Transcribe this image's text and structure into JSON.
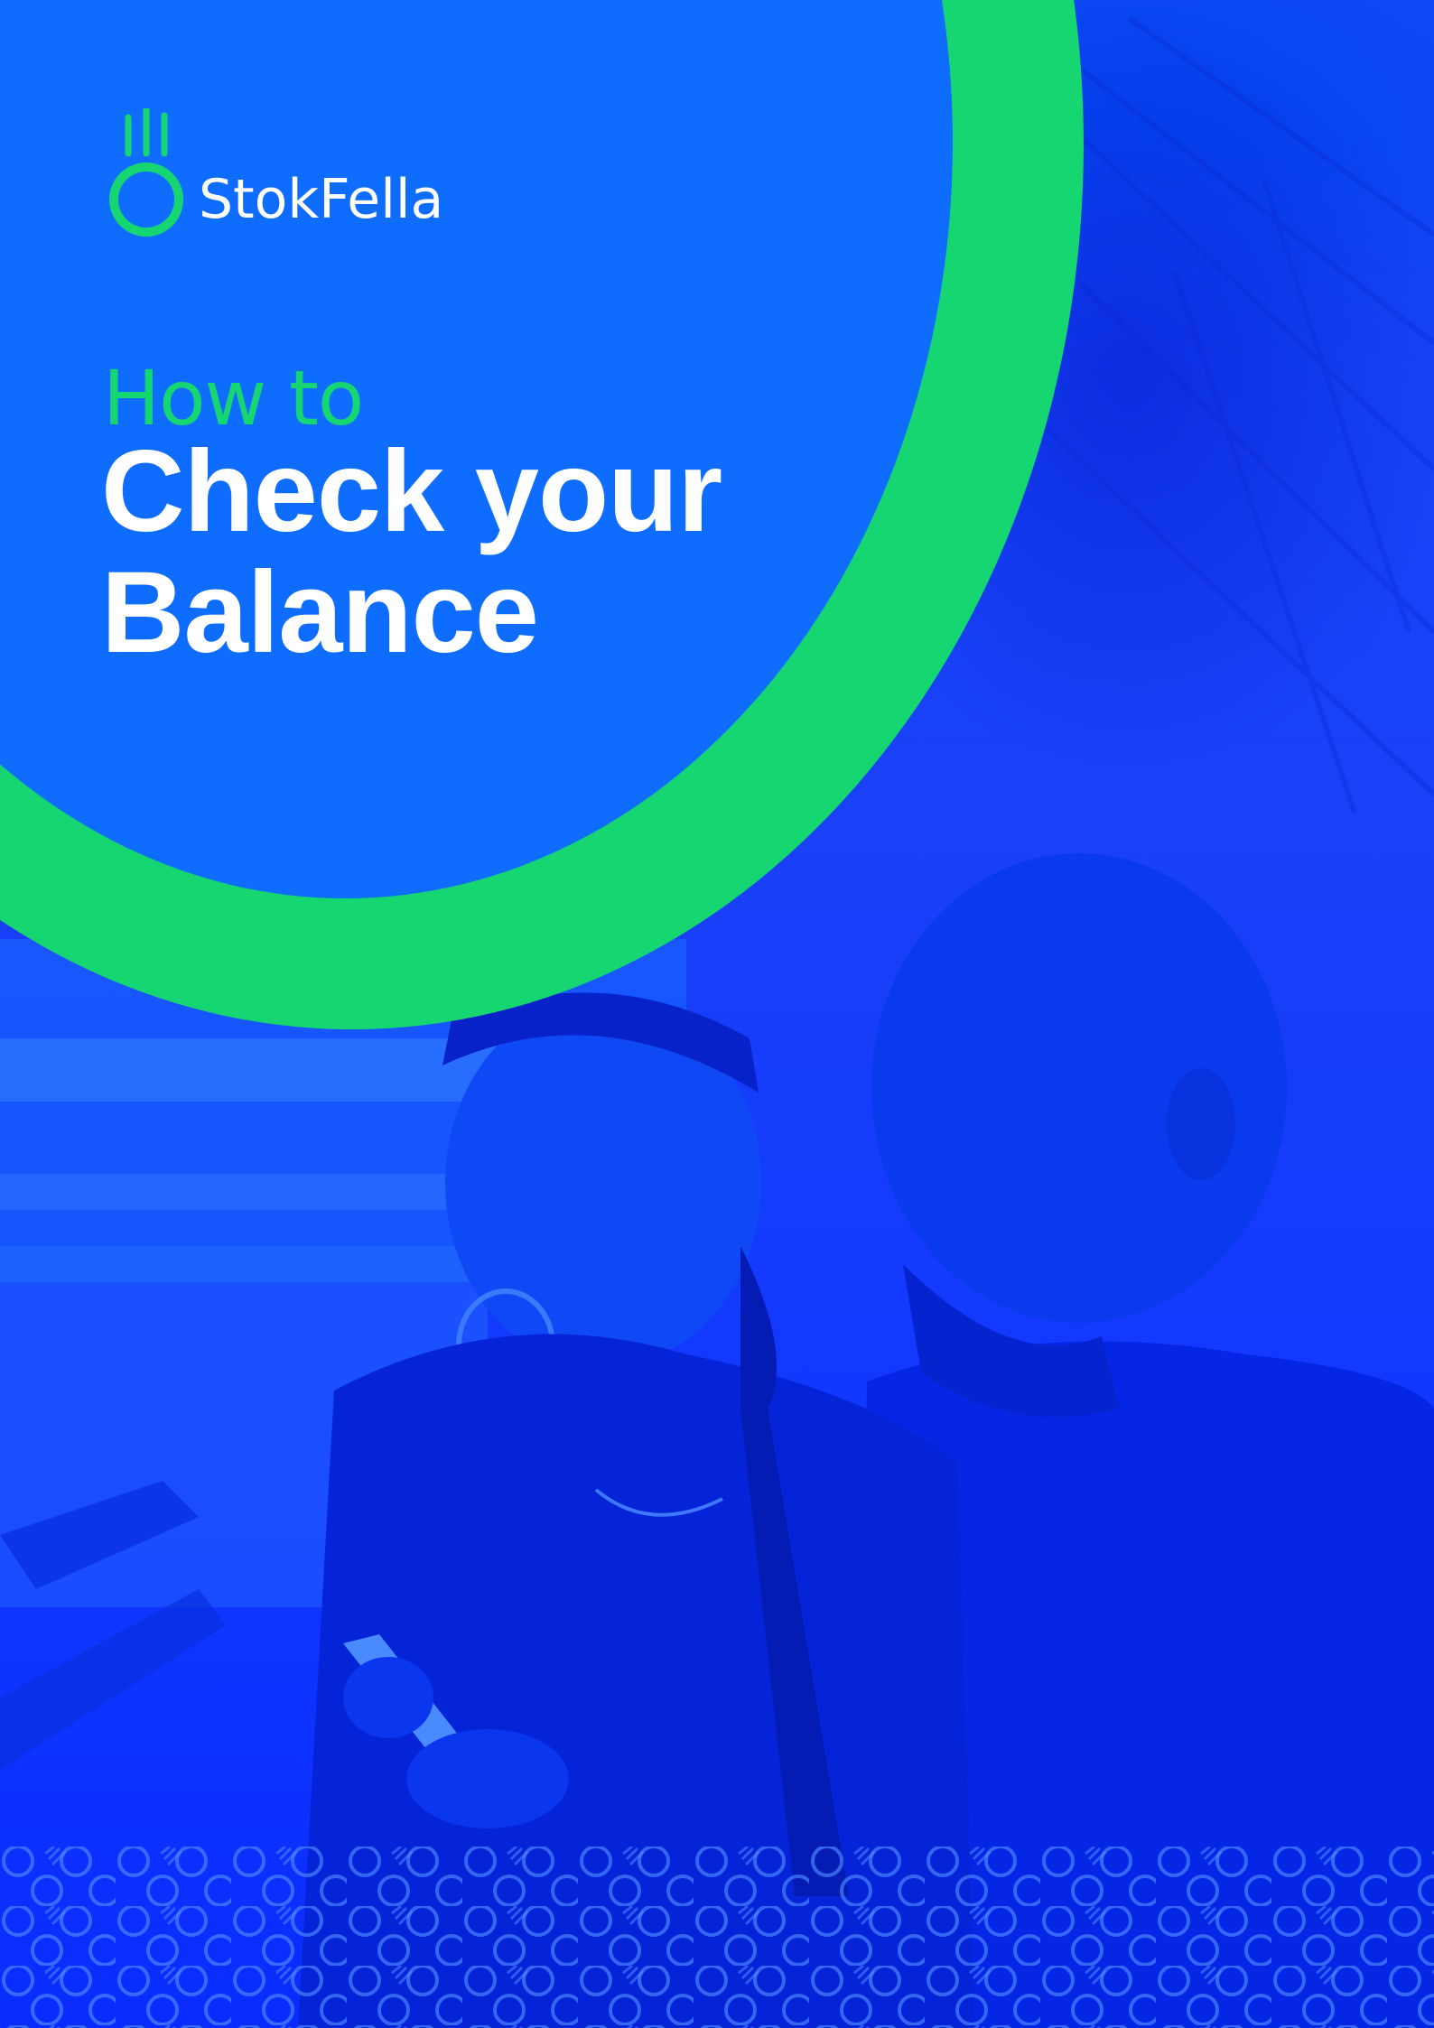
{
  "brand": {
    "name": "StokFella",
    "colors": {
      "blue": "#0e6cff",
      "deep_blue": "#1a3dff",
      "green": "#16d672",
      "white": "#ffffff"
    },
    "logo_icon": "pot-icon"
  },
  "headline": {
    "kicker": "How to",
    "title_line1": "Check your",
    "title_line2": "Balance"
  },
  "background": {
    "photo": "duotone-photo-two-people-looking-at-phone",
    "pattern": "circle-and-slash-pattern"
  }
}
